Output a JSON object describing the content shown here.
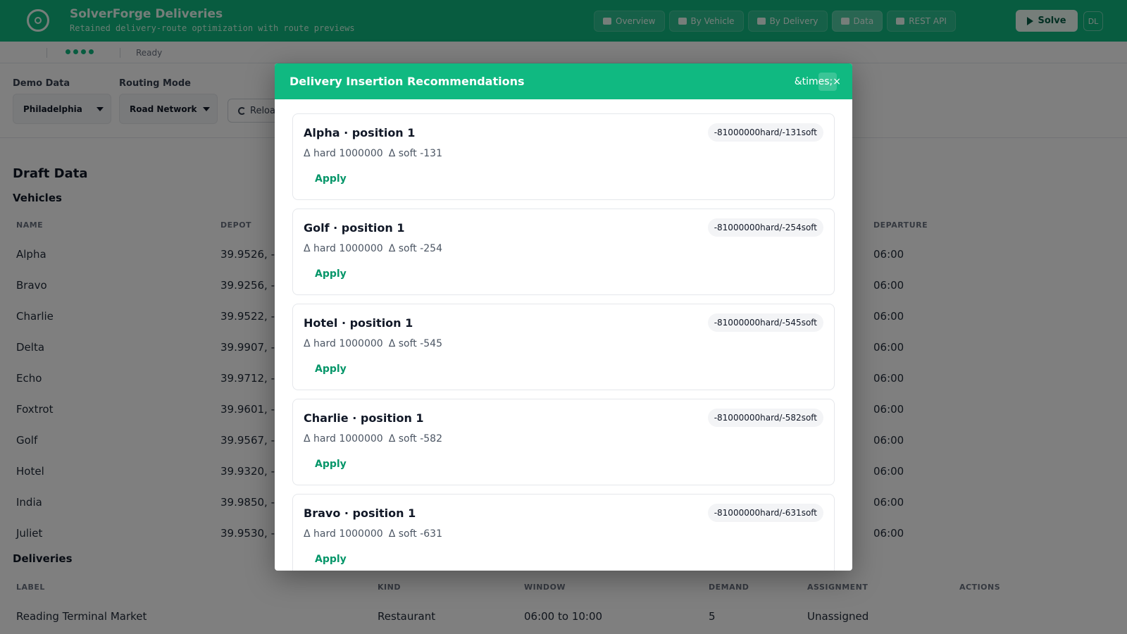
{
  "app": {
    "title": "SolverForge Deliveries",
    "subtitle": "Retained delivery-route optimization with route previews"
  },
  "nav": [
    {
      "label": "Overview",
      "icon": "map-icon"
    },
    {
      "label": "By Vehicle",
      "icon": "truck-icon"
    },
    {
      "label": "By Delivery",
      "icon": "box-icon"
    },
    {
      "label": "Data",
      "icon": "table-icon"
    },
    {
      "label": "REST API",
      "icon": "document-icon"
    }
  ],
  "solve_label": "Solve",
  "user_label": "DL",
  "status": {
    "text": "Ready"
  },
  "controls": {
    "demo_data_label": "Demo Data",
    "demo_data_value": "Philadelphia",
    "routing_mode_label": "Routing Mode",
    "routing_mode_value": "Road Network",
    "reload_label": "Reload"
  },
  "draft": {
    "title": "Draft Data",
    "vehicles_title": "Vehicles",
    "vehicle_headers": [
      "NAME",
      "DEPOT",
      "DEPARTURE"
    ],
    "vehicles": [
      {
        "name": "Alpha",
        "depot": "39.9526, -",
        "departure": "06:00"
      },
      {
        "name": "Bravo",
        "depot": "39.9256, -",
        "departure": "06:00"
      },
      {
        "name": "Charlie",
        "depot": "39.9522, -",
        "departure": "06:00"
      },
      {
        "name": "Delta",
        "depot": "39.9907, -",
        "departure": "06:00"
      },
      {
        "name": "Echo",
        "depot": "39.9712, -",
        "departure": "06:00"
      },
      {
        "name": "Foxtrot",
        "depot": "39.9601, -",
        "departure": "06:00"
      },
      {
        "name": "Golf",
        "depot": "39.9567, -",
        "departure": "06:00"
      },
      {
        "name": "Hotel",
        "depot": "39.9320, -",
        "departure": "06:00"
      },
      {
        "name": "India",
        "depot": "39.9850, -",
        "departure": "06:00"
      },
      {
        "name": "Juliet",
        "depot": "39.9530, -",
        "departure": "06:00"
      }
    ],
    "deliveries_title": "Deliveries",
    "delivery_headers": [
      "LABEL",
      "KIND",
      "WINDOW",
      "DEMAND",
      "ASSIGNMENT",
      "ACTIONS"
    ],
    "deliveries": [
      {
        "label": "Reading Terminal Market",
        "kind": "Restaurant",
        "window": "06:00 to 10:00",
        "demand": "5",
        "assignment": "Unassigned"
      }
    ]
  },
  "modal": {
    "title": "Delivery Insertion Recommendations",
    "close_label": "&times;×",
    "recommendations": [
      {
        "title": "Alpha · position 1",
        "score": "-81000000hard/-131soft",
        "delta_hard": "Δ hard 1000000",
        "delta_soft": "Δ soft -131",
        "apply_label": "Apply"
      },
      {
        "title": "Golf · position 1",
        "score": "-81000000hard/-254soft",
        "delta_hard": "Δ hard 1000000",
        "delta_soft": "Δ soft -254",
        "apply_label": "Apply"
      },
      {
        "title": "Hotel · position 1",
        "score": "-81000000hard/-545soft",
        "delta_hard": "Δ hard 1000000",
        "delta_soft": "Δ soft -545",
        "apply_label": "Apply"
      },
      {
        "title": "Charlie · position 1",
        "score": "-81000000hard/-582soft",
        "delta_hard": "Δ hard 1000000",
        "delta_soft": "Δ soft -582",
        "apply_label": "Apply"
      },
      {
        "title": "Bravo · position 1",
        "score": "-81000000hard/-631soft",
        "delta_hard": "Δ hard 1000000",
        "delta_soft": "Δ soft -631",
        "apply_label": "Apply"
      }
    ]
  },
  "colors": {
    "brand": "#10b981",
    "accent_text": "#059669"
  }
}
